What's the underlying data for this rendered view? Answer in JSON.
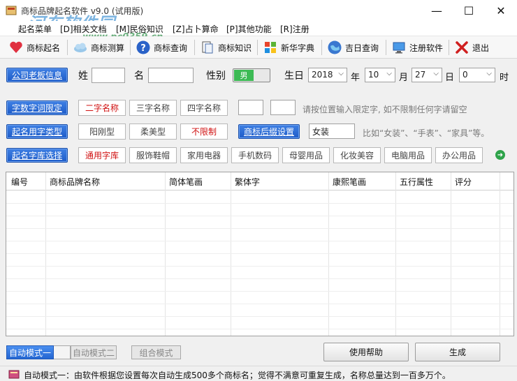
{
  "window": {
    "title": "商标品牌起名软件 v9.0 (试用版)",
    "watermark": "河东软件园",
    "watermark_url": "www.pc0359.cn",
    "minimize": "—",
    "maximize": "☐",
    "close": "✕"
  },
  "menu": [
    {
      "label": "起名菜单"
    },
    {
      "label": "[D]相关文档"
    },
    {
      "label": "[M]民俗知识"
    },
    {
      "label": "[Z]占卜算命"
    },
    {
      "label": "[P]其他功能"
    },
    {
      "label": "[R]注册"
    }
  ],
  "toolbar": [
    {
      "label": "商标起名",
      "icon": "heart-icon"
    },
    {
      "label": "商标测算",
      "icon": "cloud-icon"
    },
    {
      "label": "商标查询",
      "icon": "help-icon"
    },
    {
      "label": "商标知识",
      "icon": "document-icon"
    },
    {
      "label": "新华字典",
      "icon": "windows-icon"
    },
    {
      "label": "吉日查询",
      "icon": "globe-icon"
    },
    {
      "label": "注册软件",
      "icon": "monitor-icon"
    },
    {
      "label": "退出",
      "icon": "exit-x-icon"
    }
  ],
  "boss_info": {
    "button": "公司老板信息",
    "surname_label": "姓",
    "surname_value": "",
    "name_label": "名",
    "name_value": "",
    "gender_label": "性别",
    "gender_value": "男",
    "birthday_label": "生日",
    "year": "2018",
    "year_unit": "年",
    "month": "10",
    "month_unit": "月",
    "day": "27",
    "day_unit": "日",
    "hour": "0",
    "hour_unit": "时"
  },
  "word_limit": {
    "button": "字数字词限定",
    "options": [
      "二字名称",
      "三字名称",
      "四字名称"
    ],
    "hint": "请按位置输入限定字, 如不限制任何字请留空"
  },
  "name_type": {
    "button": "起名用字类型",
    "options": [
      "阳刚型",
      "柔美型",
      "不限制"
    ],
    "suffix_button": "商标后缀设置",
    "suffix_value": "女装",
    "hint": "比如“女装”、“手表”、“家具”等。"
  },
  "library": {
    "button": "起名字库选择",
    "options": [
      "通用字库",
      "服饰鞋帽",
      "家用电器",
      "手机数码",
      "母婴用品",
      "化妆美容",
      "电脑用品",
      "办公用品"
    ],
    "next": "➜"
  },
  "table": {
    "columns": [
      "编号",
      "商标品牌名称",
      "简体笔画",
      "繁体字",
      "康熙笔画",
      "五行属性",
      "评分"
    ]
  },
  "modes": [
    "自动模式一",
    "自动模式二",
    "组合模式"
  ],
  "help_button": "使用帮助",
  "generate_button": "生成",
  "status": "自动模式一：由软件根据您设置每次自动生成500多个商标名；觉得不满意可重复生成，名称总量达到一百多万个。"
}
